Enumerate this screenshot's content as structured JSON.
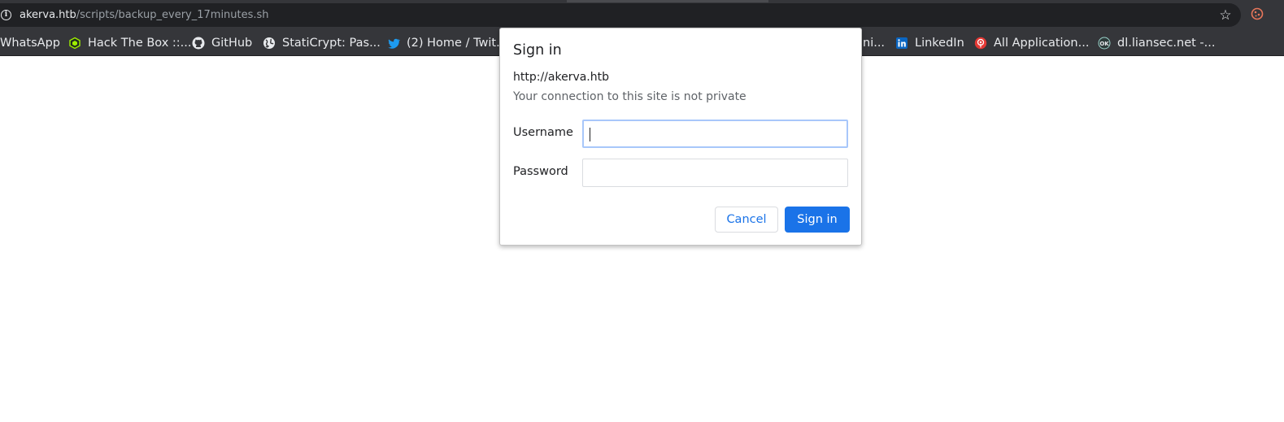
{
  "browser": {
    "url_host": "akerva.htb",
    "url_path": "/scripts/backup_every_17minutes.sh",
    "site_info_icon": "info-icon",
    "bookmark_star_icon": "star-icon",
    "extension_icon": "cookie-icon"
  },
  "bookmarks": [
    {
      "label": "WhatsApp",
      "icon": "whatsapp-icon"
    },
    {
      "label": "Hack The Box ::...",
      "icon": "hackthebox-icon"
    },
    {
      "label": "GitHub",
      "icon": "github-icon"
    },
    {
      "label": "StatiCrypt: Pas...",
      "icon": "globe-icon"
    },
    {
      "label": "(2) Home / Twit...",
      "icon": "twitter-icon"
    },
    {
      "label": "ni...",
      "icon": ""
    },
    {
      "label": "LinkedIn",
      "icon": "linkedin-icon"
    },
    {
      "label": "All Application...",
      "icon": "radar-icon"
    },
    {
      "label": "dl.liansec.net -...",
      "icon": "ok-icon"
    }
  ],
  "dialog": {
    "title": "Sign in",
    "origin": "http://akerva.htb",
    "warning": "Your connection to this site is not private",
    "username_label": "Username",
    "username_value": "",
    "password_label": "Password",
    "password_value": "",
    "cancel_label": "Cancel",
    "signin_label": "Sign in"
  },
  "colors": {
    "accent": "#1a73e8",
    "chrome_dark": "#35363a",
    "omnibox": "#202124"
  }
}
